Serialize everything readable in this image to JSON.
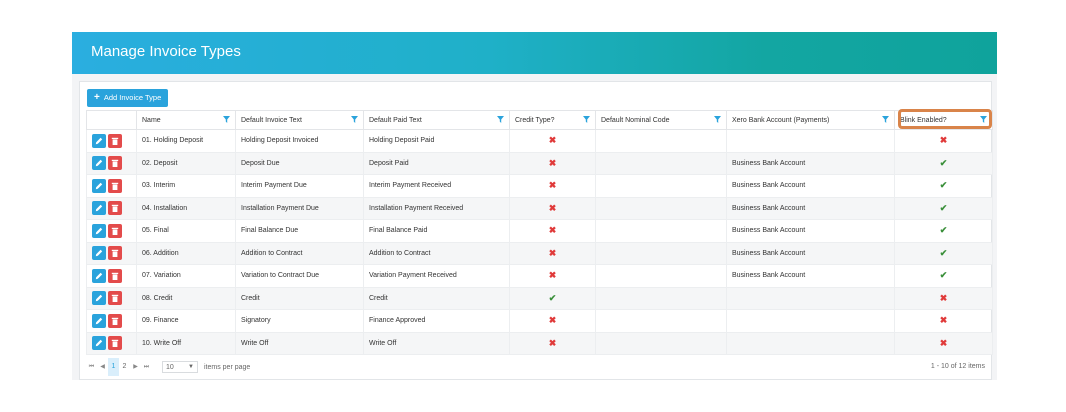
{
  "header": {
    "title": "Manage Invoice Types"
  },
  "toolbar": {
    "add_label": "Add Invoice Type"
  },
  "columns": [
    "Name",
    "Default Invoice Text",
    "Default Paid Text",
    "Credit Type?",
    "Default Nominal Code",
    "Xero Bank Account (Payments)",
    "Blink Enabled?"
  ],
  "rows": [
    {
      "name": "01. Holding Deposit",
      "invoice_text": "Holding Deposit Invoiced",
      "paid_text": "Holding Deposit Paid",
      "credit": false,
      "nominal": "",
      "bank": "",
      "blink": false
    },
    {
      "name": "02. Deposit",
      "invoice_text": "Deposit Due",
      "paid_text": "Deposit Paid",
      "credit": false,
      "nominal": "",
      "bank": "Business Bank Account",
      "blink": true
    },
    {
      "name": "03. Interim",
      "invoice_text": "Interim Payment Due",
      "paid_text": "Interim Payment Received",
      "credit": false,
      "nominal": "",
      "bank": "Business Bank Account",
      "blink": true
    },
    {
      "name": "04. Installation",
      "invoice_text": "Installation Payment Due",
      "paid_text": "Installation Payment Received",
      "credit": false,
      "nominal": "",
      "bank": "Business Bank Account",
      "blink": true
    },
    {
      "name": "05. Final",
      "invoice_text": "Final Balance Due",
      "paid_text": "Final Balance Paid",
      "credit": false,
      "nominal": "",
      "bank": "Business Bank Account",
      "blink": true
    },
    {
      "name": "06. Addition",
      "invoice_text": "Addition to Contract",
      "paid_text": "Addition to Contract",
      "credit": false,
      "nominal": "",
      "bank": "Business Bank Account",
      "blink": true
    },
    {
      "name": "07. Variation",
      "invoice_text": "Variation to Contract Due",
      "paid_text": "Variation Payment Received",
      "credit": false,
      "nominal": "",
      "bank": "Business Bank Account",
      "blink": true
    },
    {
      "name": "08. Credit",
      "invoice_text": "Credit",
      "paid_text": "Credit",
      "credit": true,
      "nominal": "",
      "bank": "",
      "blink": false
    },
    {
      "name": "09. Finance",
      "invoice_text": "Signatory",
      "paid_text": "Finance Approved",
      "credit": false,
      "nominal": "",
      "bank": "",
      "blink": false
    },
    {
      "name": "10. Write Off",
      "invoice_text": "Write Off",
      "paid_text": "Write Off",
      "credit": false,
      "nominal": "",
      "bank": "",
      "blink": false
    }
  ],
  "pager": {
    "first": "⏮",
    "prev": "◀",
    "pages": [
      "1",
      "2"
    ],
    "next": "▶",
    "last": "⏭",
    "per_page": "10",
    "per_page_label": "items per page",
    "count": "1 - 10 of 12 items"
  },
  "colors": {
    "accent": "#2aa3dc",
    "delete": "#e34b4b",
    "highlight": "#d9844a",
    "check": "#3a8f3a",
    "cross": "#e03a3a"
  },
  "icons": {
    "edit": "pencil-icon",
    "delete": "trash-icon",
    "filter": "filter-icon",
    "true": "check-icon",
    "false": "cross-icon"
  }
}
